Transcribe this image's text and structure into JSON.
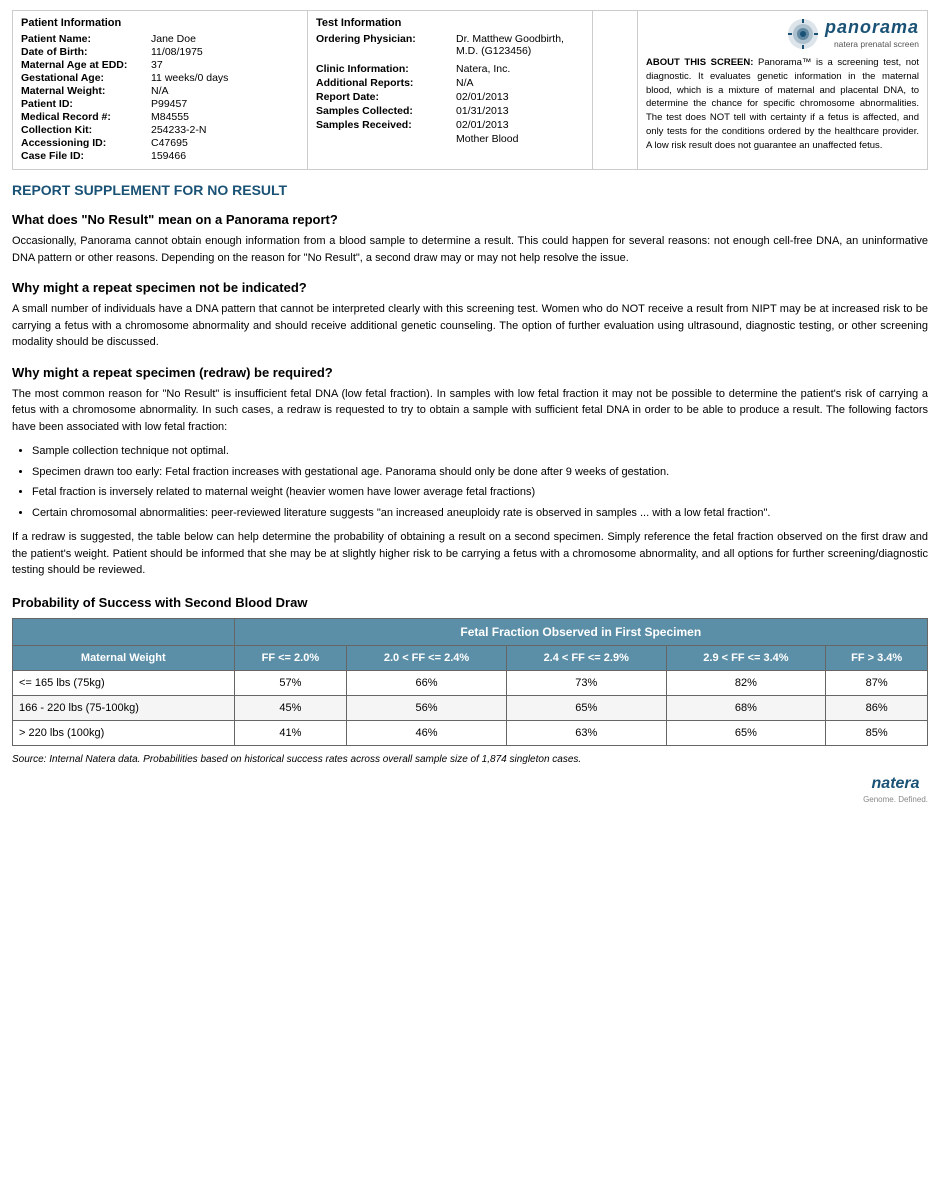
{
  "logo": {
    "brand": "panorama",
    "tagline": "natera prenatal screen"
  },
  "patient_info": {
    "section_title": "Patient Information",
    "fields": [
      {
        "label": "Patient Name:",
        "value": "Jane Doe"
      },
      {
        "label": "Date of Birth:",
        "value": "11/08/1975"
      },
      {
        "label": "Maternal Age at EDD:",
        "value": "37"
      },
      {
        "label": "Gestational Age:",
        "value": "11 weeks/0 days"
      },
      {
        "label": "Maternal Weight:",
        "value": "N/A"
      },
      {
        "label": "Patient ID:",
        "value": "P99457"
      },
      {
        "label": "Medical Record #:",
        "value": "M84555"
      },
      {
        "label": "Collection Kit:",
        "value": "254233-2-N"
      },
      {
        "label": "Accessioning ID:",
        "value": "C47695"
      },
      {
        "label": "Case File ID:",
        "value": "159466"
      }
    ]
  },
  "test_info": {
    "section_title": "Test Information",
    "fields": [
      {
        "label": "Ordering Physician:",
        "value": "Dr. Matthew Goodbirth, M.D. (G123456)"
      },
      {
        "label": "Clinic Information:",
        "value": "Natera, Inc."
      },
      {
        "label": "Additional Reports:",
        "value": "N/A"
      },
      {
        "label": "Report Date:",
        "value": "02/01/2013"
      },
      {
        "label": "Samples Collected:",
        "value": "01/31/2013"
      },
      {
        "label": "Samples Received:",
        "value": "02/01/2013"
      },
      {
        "label": "collection_sub",
        "value": "Mother Blood"
      }
    ]
  },
  "about": {
    "title": "ABOUT THIS SCREEN:",
    "text": "Panorama™ is a screening test, not diagnostic. It evaluates genetic information in the maternal blood, which is a mixture of maternal and placental DNA, to determine the chance for specific chromosome abnormalities. The test does NOT tell with certainty if a fetus is affected, and only tests for the conditions ordered by the healthcare provider. A low risk result does not guarantee an unaffected fetus."
  },
  "report_supplement": {
    "title": "REPORT SUPPLEMENT for NO RESULT",
    "q1_heading": "What does \"No Result\" mean on a Panorama report?",
    "q1_body": "Occasionally, Panorama cannot obtain enough information from a blood sample to determine a result. This could happen for several reasons: not enough cell-free DNA, an uninformative DNA pattern or other reasons. Depending on the reason for \"No Result\", a second draw may or may not help resolve the issue.",
    "q2_heading": "Why might a repeat specimen not be indicated?",
    "q2_body": "A small number of individuals have a DNA pattern that cannot be interpreted clearly with this screening test. Women who do NOT receive a result from NIPT may be at increased risk to be carrying a fetus with a chromosome abnormality and should receive additional genetic counseling. The option of further evaluation using ultrasound, diagnostic testing, or other screening modality should be discussed.",
    "q3_heading": "Why might a repeat specimen (redraw) be required?",
    "q3_intro": "The most common reason for \"No Result\" is insufficient fetal DNA (low fetal fraction). In samples with low fetal fraction it may not be possible to determine the patient's risk of carrying a fetus with a chromosome abnormality. In such cases, a redraw is requested to try to obtain a sample with sufficient fetal DNA in order to be able to produce a result. The following factors have been associated with low fetal fraction:",
    "bullets": [
      "Sample collection technique not optimal.",
      "Specimen drawn too early: Fetal fraction increases with gestational age. Panorama should only be done after 9 weeks of gestation.",
      "Fetal fraction is inversely related to maternal weight (heavier women have lower average fetal fractions)",
      "Certain chromosomal abnormalities: peer-reviewed literature suggests \"an increased aneuploidy rate is observed in samples ... with a low fetal fraction\"."
    ],
    "q3_closing": "If a redraw is suggested, the table below can help determine the probability of obtaining a result on a second specimen. Simply reference the fetal fraction observed on the first draw and the patient's weight. Patient should be informed that she may be at slightly higher risk to be carrying a fetus with a chromosome abnormality, and all options for further screening/diagnostic testing should be reviewed.",
    "probability_title": "Probability of Success with Second Blood Draw",
    "table": {
      "top_header": "Fetal Fraction Observed in First Specimen",
      "col_headers": [
        "Maternal Weight",
        "FF <= 2.0%",
        "2.0 < FF <= 2.4%",
        "2.4 < FF <= 2.9%",
        "2.9 < FF <= 3.4%",
        "FF > 3.4%"
      ],
      "rows": [
        {
          "weight": "<= 165 lbs (75kg)",
          "values": [
            "57%",
            "66%",
            "73%",
            "82%",
            "87%"
          ]
        },
        {
          "weight": "166 - 220 lbs (75-100kg)",
          "values": [
            "45%",
            "56%",
            "65%",
            "68%",
            "86%"
          ]
        },
        {
          "weight": "> 220 lbs (100kg)",
          "values": [
            "41%",
            "46%",
            "63%",
            "65%",
            "85%"
          ]
        }
      ]
    },
    "source_text": "Source: Internal Natera data. Probabilities based on historical success rates across overall sample size of 1,874 singleton cases."
  },
  "footer": {
    "brand": "natera",
    "tagline_line1": "Genome. Defined."
  }
}
